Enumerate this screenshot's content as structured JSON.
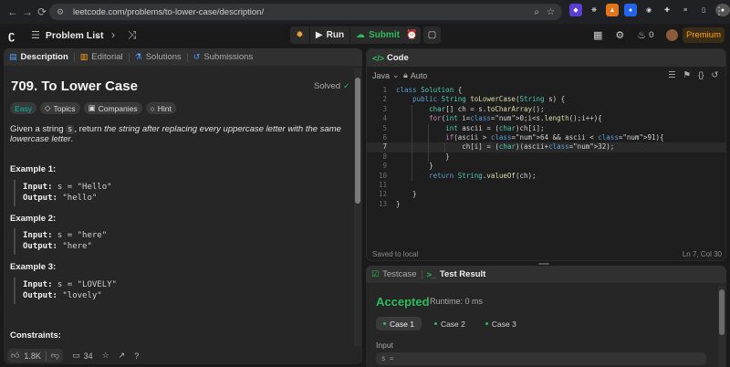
{
  "browser": {
    "url": "leetcode.com/problems/to-lower-case/description/"
  },
  "header": {
    "problem_list": "Problem List",
    "run_label": "Run",
    "submit_label": "Submit",
    "streak_count": "0",
    "premium_label": "Premium"
  },
  "left": {
    "tabs": [
      {
        "label": "Description"
      },
      {
        "label": "Editorial"
      },
      {
        "label": "Solutions"
      },
      {
        "label": "Submissions"
      }
    ],
    "title": "709. To Lower Case",
    "solved": "Solved",
    "tags": [
      {
        "label": "Easy"
      },
      {
        "label": "Topics"
      },
      {
        "label": "Companies"
      },
      {
        "label": "Hint"
      }
    ],
    "desc_1": "Given a string ",
    "desc_code": "s",
    "desc_2": ", return ",
    "desc_em": "the string after replacing every uppercase letter with the same lowercase letter",
    "desc_3": ".",
    "examples": [
      {
        "title": "Example 1:",
        "input_label": "Input:",
        "input": " s = \"Hello\"",
        "output_label": "Output:",
        "output": " \"hello\""
      },
      {
        "title": "Example 2:",
        "input_label": "Input:",
        "input": " s = \"here\"",
        "output_label": "Output:",
        "output": " \"here\""
      },
      {
        "title": "Example 3:",
        "input_label": "Input:",
        "input": " s = \"LOVELY\"",
        "output_label": "Output:",
        "output": " \"lovely\""
      }
    ],
    "constraints_title": "Constraints:",
    "likes": "1.8K",
    "comments": "34"
  },
  "code": {
    "tab_label": "Code",
    "language": "Java",
    "mode": "Auto",
    "status": "Saved to local",
    "cursor": "Ln 7, Col 30",
    "lines": [
      {
        "n": "1",
        "text": "class Solution {"
      },
      {
        "n": "2",
        "text": "    public String toLowerCase(String s) {"
      },
      {
        "n": "3",
        "text": "        char[] ch = s.toCharArray();"
      },
      {
        "n": "4",
        "text": "        for(int i=0;i<s.length();i++){"
      },
      {
        "n": "5",
        "text": "            int ascii = (char)ch[i];"
      },
      {
        "n": "6",
        "text": "            if(ascii > 64 && ascii < 91){"
      },
      {
        "n": "7",
        "text": "                ch[i] = (char)(ascii+32);"
      },
      {
        "n": "8",
        "text": "            }"
      },
      {
        "n": "9",
        "text": "        }"
      },
      {
        "n": "10",
        "text": "        return String.valueOf(ch);"
      },
      {
        "n": "11",
        "text": ""
      },
      {
        "n": "12",
        "text": "    }"
      },
      {
        "n": "13",
        "text": "}"
      }
    ]
  },
  "test": {
    "tabs": [
      {
        "label": "Testcase"
      },
      {
        "label": "Test Result"
      }
    ],
    "result": "Accepted",
    "runtime": "Runtime: 0 ms",
    "cases": [
      {
        "label": "Case 1"
      },
      {
        "label": "Case 2"
      },
      {
        "label": "Case 3"
      }
    ],
    "input_label": "Input",
    "input_value": "s ="
  },
  "colors": {
    "accent_green": "#2cbb5d",
    "accent_orange": "#ffa116",
    "easy_teal": "#00b8a3"
  }
}
